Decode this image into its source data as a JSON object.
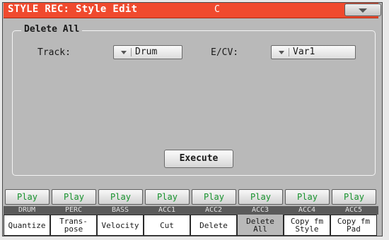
{
  "title": {
    "text": "STYLE REC: Style Edit",
    "key": "C",
    "menu_icon": "menu-arrow-icon"
  },
  "panel": {
    "title": "Delete All",
    "track_label": "Track:",
    "track_value": "Drum",
    "ecv_label": "E/CV:",
    "ecv_value": "Var1",
    "execute_label": "Execute"
  },
  "tracks": [
    {
      "play": "Play",
      "name": "DRUM"
    },
    {
      "play": "Play",
      "name": "PERC"
    },
    {
      "play": "Play",
      "name": "BASS"
    },
    {
      "play": "Play",
      "name": "ACC1"
    },
    {
      "play": "Play",
      "name": "ACC2"
    },
    {
      "play": "Play",
      "name": "ACC3"
    },
    {
      "play": "Play",
      "name": "ACC4"
    },
    {
      "play": "Play",
      "name": "ACC5"
    }
  ],
  "tabs": [
    {
      "line1": "Quantize",
      "line2": ""
    },
    {
      "line1": "Trans-",
      "line2": "pose"
    },
    {
      "line1": "Velocity",
      "line2": ""
    },
    {
      "line1": "Cut",
      "line2": ""
    },
    {
      "line1": "Delete",
      "line2": ""
    },
    {
      "line1": "Delete",
      "line2": "All"
    },
    {
      "line1": "Copy fm",
      "line2": "Style"
    },
    {
      "line1": "Copy fm",
      "line2": "Pad"
    }
  ],
  "active_tab": 5,
  "colors": {
    "title_bar": "#f04a2e",
    "play_text": "#16922c",
    "lcd": "#b9b9b9"
  }
}
